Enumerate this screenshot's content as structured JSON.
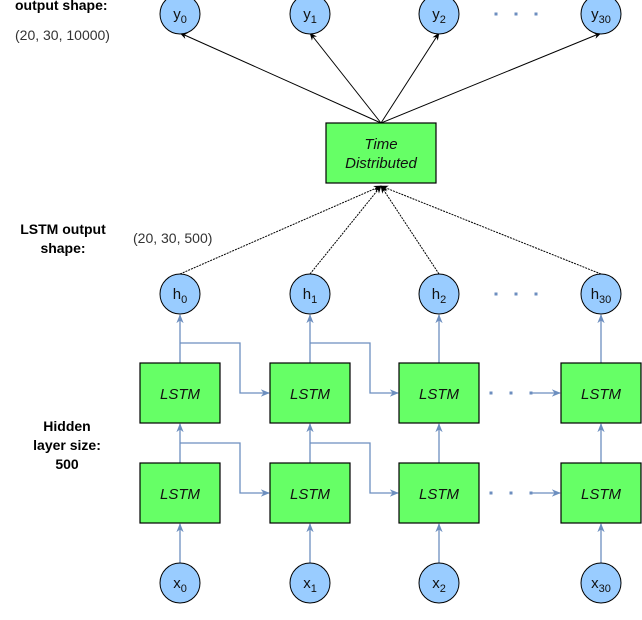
{
  "labels": {
    "output_shape_title": "output shape:",
    "output_shape_value": "(20, 30, 10000)",
    "lstm_output_title_line1": "LSTM output",
    "lstm_output_title_line2": "shape:",
    "lstm_output_value": "(20, 30, 500)",
    "hidden_line1": "Hidden",
    "hidden_line2": "layer size:",
    "hidden_line3": "500"
  },
  "time_distributed": {
    "line1": "Time",
    "line2": "Distributed"
  },
  "lstm_label": "LSTM",
  "outputs": [
    {
      "base": "y",
      "sub": "0"
    },
    {
      "base": "y",
      "sub": "1"
    },
    {
      "base": "y",
      "sub": "2"
    },
    {
      "base": "y",
      "sub": "30"
    }
  ],
  "hidden": [
    {
      "base": "h",
      "sub": "0"
    },
    {
      "base": "h",
      "sub": "1"
    },
    {
      "base": "h",
      "sub": "2"
    },
    {
      "base": "h",
      "sub": "30"
    }
  ],
  "inputs": [
    {
      "base": "x",
      "sub": "0"
    },
    {
      "base": "x",
      "sub": "1"
    },
    {
      "base": "x",
      "sub": "2"
    },
    {
      "base": "x",
      "sub": "30"
    }
  ],
  "colors": {
    "node_fill": "#99ccff",
    "box_fill": "#66ff66",
    "connector": "#6c8ebf"
  }
}
